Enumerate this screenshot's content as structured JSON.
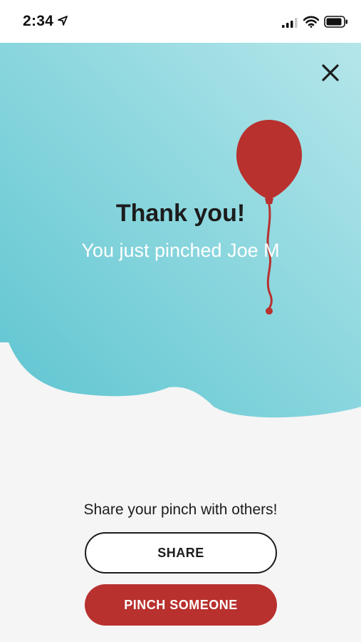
{
  "status_bar": {
    "time": "2:34",
    "icons": [
      "location-arrow-icon",
      "signal-icon",
      "wifi-icon",
      "battery-icon"
    ]
  },
  "header": {
    "close_icon": "close-icon"
  },
  "hero": {
    "title": "Thank you!",
    "subtitle": "You just pinched Joe M",
    "illustration": "balloon-icon"
  },
  "share": {
    "prompt": "Share your pinch with others!",
    "share_label": "SHARE",
    "pinch_label": "PINCH SOMEONE"
  },
  "colors": {
    "hero_light": "#b4e6ea",
    "hero_dark": "#5ec5d1",
    "balloon": "#b8312f",
    "primary_button": "#b8312f",
    "background": "#f5f5f5"
  }
}
